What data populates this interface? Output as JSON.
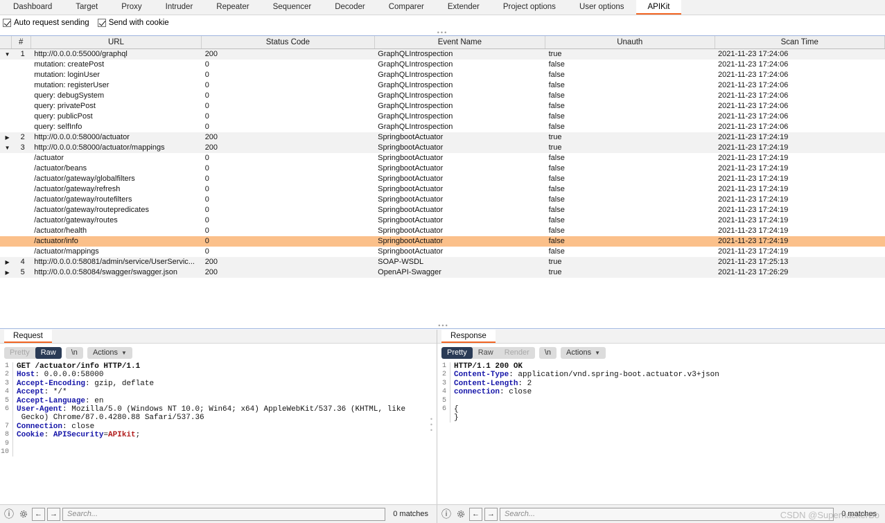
{
  "top_tabs": [
    {
      "label": "Dashboard",
      "active": false
    },
    {
      "label": "Target",
      "active": false
    },
    {
      "label": "Proxy",
      "active": false
    },
    {
      "label": "Intruder",
      "active": false
    },
    {
      "label": "Repeater",
      "active": false
    },
    {
      "label": "Sequencer",
      "active": false
    },
    {
      "label": "Decoder",
      "active": false
    },
    {
      "label": "Comparer",
      "active": false
    },
    {
      "label": "Extender",
      "active": false
    },
    {
      "label": "Project options",
      "active": false
    },
    {
      "label": "User options",
      "active": false
    },
    {
      "label": "APIKit",
      "active": true
    }
  ],
  "options": {
    "auto_request_sending": {
      "label": "Auto request sending",
      "checked": true
    },
    "send_with_cookie": {
      "label": "Send with cookie",
      "checked": true
    }
  },
  "table": {
    "columns": [
      "",
      "#",
      "URL",
      "Status Code",
      "Event Name",
      "Unauth",
      "Scan Time"
    ],
    "rows": [
      {
        "arrow": "down",
        "idx": "1",
        "url": "http://0.0.0.0:55000/graphql",
        "child": false,
        "status": "200",
        "event": "GraphQLIntrospection",
        "unauth": "true",
        "time": "2021-11-23 17:24:06",
        "style": "alt"
      },
      {
        "arrow": "",
        "idx": "",
        "url": "mutation: createPost",
        "child": true,
        "status": "0",
        "event": "GraphQLIntrospection",
        "unauth": "false",
        "time": "2021-11-23 17:24:06",
        "style": "plain"
      },
      {
        "arrow": "",
        "idx": "",
        "url": "mutation: loginUser",
        "child": true,
        "status": "0",
        "event": "GraphQLIntrospection",
        "unauth": "false",
        "time": "2021-11-23 17:24:06",
        "style": "plain"
      },
      {
        "arrow": "",
        "idx": "",
        "url": "mutation: registerUser",
        "child": true,
        "status": "0",
        "event": "GraphQLIntrospection",
        "unauth": "false",
        "time": "2021-11-23 17:24:06",
        "style": "plain"
      },
      {
        "arrow": "",
        "idx": "",
        "url": "query: debugSystem",
        "child": true,
        "status": "0",
        "event": "GraphQLIntrospection",
        "unauth": "false",
        "time": "2021-11-23 17:24:06",
        "style": "plain"
      },
      {
        "arrow": "",
        "idx": "",
        "url": "query: privatePost",
        "child": true,
        "status": "0",
        "event": "GraphQLIntrospection",
        "unauth": "false",
        "time": "2021-11-23 17:24:06",
        "style": "plain"
      },
      {
        "arrow": "",
        "idx": "",
        "url": "query: publicPost",
        "child": true,
        "status": "0",
        "event": "GraphQLIntrospection",
        "unauth": "false",
        "time": "2021-11-23 17:24:06",
        "style": "plain"
      },
      {
        "arrow": "",
        "idx": "",
        "url": "query: selfInfo",
        "child": true,
        "status": "0",
        "event": "GraphQLIntrospection",
        "unauth": "false",
        "time": "2021-11-23 17:24:06",
        "style": "plain"
      },
      {
        "arrow": "right",
        "idx": "2",
        "url": "http://0.0.0.0:58000/actuator",
        "child": false,
        "status": "200",
        "event": "SpringbootActuator",
        "unauth": "true",
        "time": "2021-11-23 17:24:19",
        "style": "alt"
      },
      {
        "arrow": "down",
        "idx": "3",
        "url": "http://0.0.0.0:58000/actuator/mappings",
        "child": false,
        "status": "200",
        "event": "SpringbootActuator",
        "unauth": "true",
        "time": "2021-11-23 17:24:19",
        "style": "alt"
      },
      {
        "arrow": "",
        "idx": "",
        "url": "/actuator",
        "child": true,
        "status": "0",
        "event": "SpringbootActuator",
        "unauth": "false",
        "time": "2021-11-23 17:24:19",
        "style": "plain"
      },
      {
        "arrow": "",
        "idx": "",
        "url": "/actuator/beans",
        "child": true,
        "status": "0",
        "event": "SpringbootActuator",
        "unauth": "false",
        "time": "2021-11-23 17:24:19",
        "style": "plain"
      },
      {
        "arrow": "",
        "idx": "",
        "url": "/actuator/gateway/globalfilters",
        "child": true,
        "status": "0",
        "event": "SpringbootActuator",
        "unauth": "false",
        "time": "2021-11-23 17:24:19",
        "style": "plain"
      },
      {
        "arrow": "",
        "idx": "",
        "url": "/actuator/gateway/refresh",
        "child": true,
        "status": "0",
        "event": "SpringbootActuator",
        "unauth": "false",
        "time": "2021-11-23 17:24:19",
        "style": "plain"
      },
      {
        "arrow": "",
        "idx": "",
        "url": "/actuator/gateway/routefilters",
        "child": true,
        "status": "0",
        "event": "SpringbootActuator",
        "unauth": "false",
        "time": "2021-11-23 17:24:19",
        "style": "plain"
      },
      {
        "arrow": "",
        "idx": "",
        "url": "/actuator/gateway/routepredicates",
        "child": true,
        "status": "0",
        "event": "SpringbootActuator",
        "unauth": "false",
        "time": "2021-11-23 17:24:19",
        "style": "plain"
      },
      {
        "arrow": "",
        "idx": "",
        "url": "/actuator/gateway/routes",
        "child": true,
        "status": "0",
        "event": "SpringbootActuator",
        "unauth": "false",
        "time": "2021-11-23 17:24:19",
        "style": "plain"
      },
      {
        "arrow": "",
        "idx": "",
        "url": "/actuator/health",
        "child": true,
        "status": "0",
        "event": "SpringbootActuator",
        "unauth": "false",
        "time": "2021-11-23 17:24:19",
        "style": "plain"
      },
      {
        "arrow": "",
        "idx": "",
        "url": "/actuator/info",
        "child": true,
        "status": "0",
        "event": "SpringbootActuator",
        "unauth": "false",
        "time": "2021-11-23 17:24:19",
        "style": "sel"
      },
      {
        "arrow": "",
        "idx": "",
        "url": "/actuator/mappings",
        "child": true,
        "status": "0",
        "event": "SpringbootActuator",
        "unauth": "false",
        "time": "2021-11-23 17:24:19",
        "style": "plain"
      },
      {
        "arrow": "right",
        "idx": "4",
        "url": "http://0.0.0.0:58081/admin/service/UserServic...",
        "child": false,
        "status": "200",
        "event": "SOAP-WSDL",
        "unauth": "true",
        "time": "2021-11-23 17:25:13",
        "style": "alt"
      },
      {
        "arrow": "right",
        "idx": "5",
        "url": "http://0.0.0.0:58084/swagger/swagger.json",
        "child": false,
        "status": "200",
        "event": "OpenAPI-Swagger",
        "unauth": "true",
        "time": "2021-11-23 17:26:29",
        "style": "alt"
      }
    ]
  },
  "request": {
    "tab_label": "Request",
    "view_modes": [
      {
        "label": "Pretty",
        "state": "dim"
      },
      {
        "label": "Raw",
        "state": "on"
      }
    ],
    "newline_label": "\\n",
    "actions_label": "Actions",
    "lines": [
      {
        "n": "1",
        "segments": [
          {
            "t": "GET /actuator/info HTTP/1.1",
            "c": "h-stat"
          }
        ]
      },
      {
        "n": "2",
        "segments": [
          {
            "t": "Host",
            "c": "h-key"
          },
          {
            "t": ": 0.0.0.0:58000",
            "c": "h-val"
          }
        ]
      },
      {
        "n": "3",
        "segments": [
          {
            "t": "Accept-Encoding",
            "c": "h-key"
          },
          {
            "t": ": gzip, deflate",
            "c": "h-val"
          }
        ]
      },
      {
        "n": "4",
        "segments": [
          {
            "t": "Accept",
            "c": "h-key"
          },
          {
            "t": ": */*",
            "c": "h-val"
          }
        ]
      },
      {
        "n": "5",
        "segments": [
          {
            "t": "Accept-Language",
            "c": "h-key"
          },
          {
            "t": ": en",
            "c": "h-val"
          }
        ]
      },
      {
        "n": "6",
        "segments": [
          {
            "t": "User-Agent",
            "c": "h-key"
          },
          {
            "t": ": Mozilla/5.0 (Windows NT 10.0; Win64; x64) AppleWebKit/537.36 (KHTML, like",
            "c": "h-val"
          }
        ]
      },
      {
        "n": "",
        "segments": [
          {
            "t": " Gecko) Chrome/87.0.4280.88 Safari/537.36",
            "c": "h-val"
          }
        ]
      },
      {
        "n": "7",
        "segments": [
          {
            "t": "Connection",
            "c": "h-key"
          },
          {
            "t": ": close",
            "c": "h-val"
          }
        ]
      },
      {
        "n": "8",
        "segments": [
          {
            "t": "Cookie",
            "c": "h-key"
          },
          {
            "t": ": ",
            "c": "h-val"
          },
          {
            "t": "APISecurity",
            "c": "h-key"
          },
          {
            "t": "=",
            "c": "h-val"
          },
          {
            "t": "APIkit",
            "c": "h-red"
          },
          {
            "t": ";",
            "c": "h-val"
          }
        ]
      },
      {
        "n": "9",
        "segments": [
          {
            "t": "",
            "c": "h-val"
          }
        ]
      },
      {
        "n": "10",
        "segments": [
          {
            "t": "",
            "c": "h-val"
          }
        ]
      }
    ],
    "search_placeholder": "Search...",
    "matches_label": "0 matches"
  },
  "response": {
    "tab_label": "Response",
    "view_modes": [
      {
        "label": "Pretty",
        "state": "on"
      },
      {
        "label": "Raw",
        "state": "off"
      },
      {
        "label": "Render",
        "state": "dim"
      }
    ],
    "newline_label": "\\n",
    "actions_label": "Actions",
    "lines": [
      {
        "n": "1",
        "segments": [
          {
            "t": "HTTP/1.1 200 OK",
            "c": "h-stat"
          }
        ]
      },
      {
        "n": "2",
        "segments": [
          {
            "t": "Content-Type",
            "c": "h-key"
          },
          {
            "t": ": application/vnd.spring-boot.actuator.v3+json",
            "c": "h-val"
          }
        ]
      },
      {
        "n": "3",
        "segments": [
          {
            "t": "Content-Length",
            "c": "h-key"
          },
          {
            "t": ": 2",
            "c": "h-val"
          }
        ]
      },
      {
        "n": "4",
        "segments": [
          {
            "t": "connection",
            "c": "h-key"
          },
          {
            "t": ": close",
            "c": "h-val"
          }
        ]
      },
      {
        "n": "5",
        "segments": [
          {
            "t": "",
            "c": "h-val"
          }
        ]
      },
      {
        "n": "6",
        "segments": [
          {
            "t": "{",
            "c": "h-val"
          }
        ]
      },
      {
        "n": "",
        "segments": [
          {
            "t": "}",
            "c": "h-val"
          }
        ]
      }
    ],
    "search_placeholder": "Search...",
    "matches_label": "0 matches"
  },
  "watermark": "CSDN @SuperhackerBo",
  "colors": {
    "accent": "#f26522",
    "selected_row": "#fbc08a",
    "header_bg": "#eeeeee",
    "toggle_on": "#2a3b56"
  }
}
